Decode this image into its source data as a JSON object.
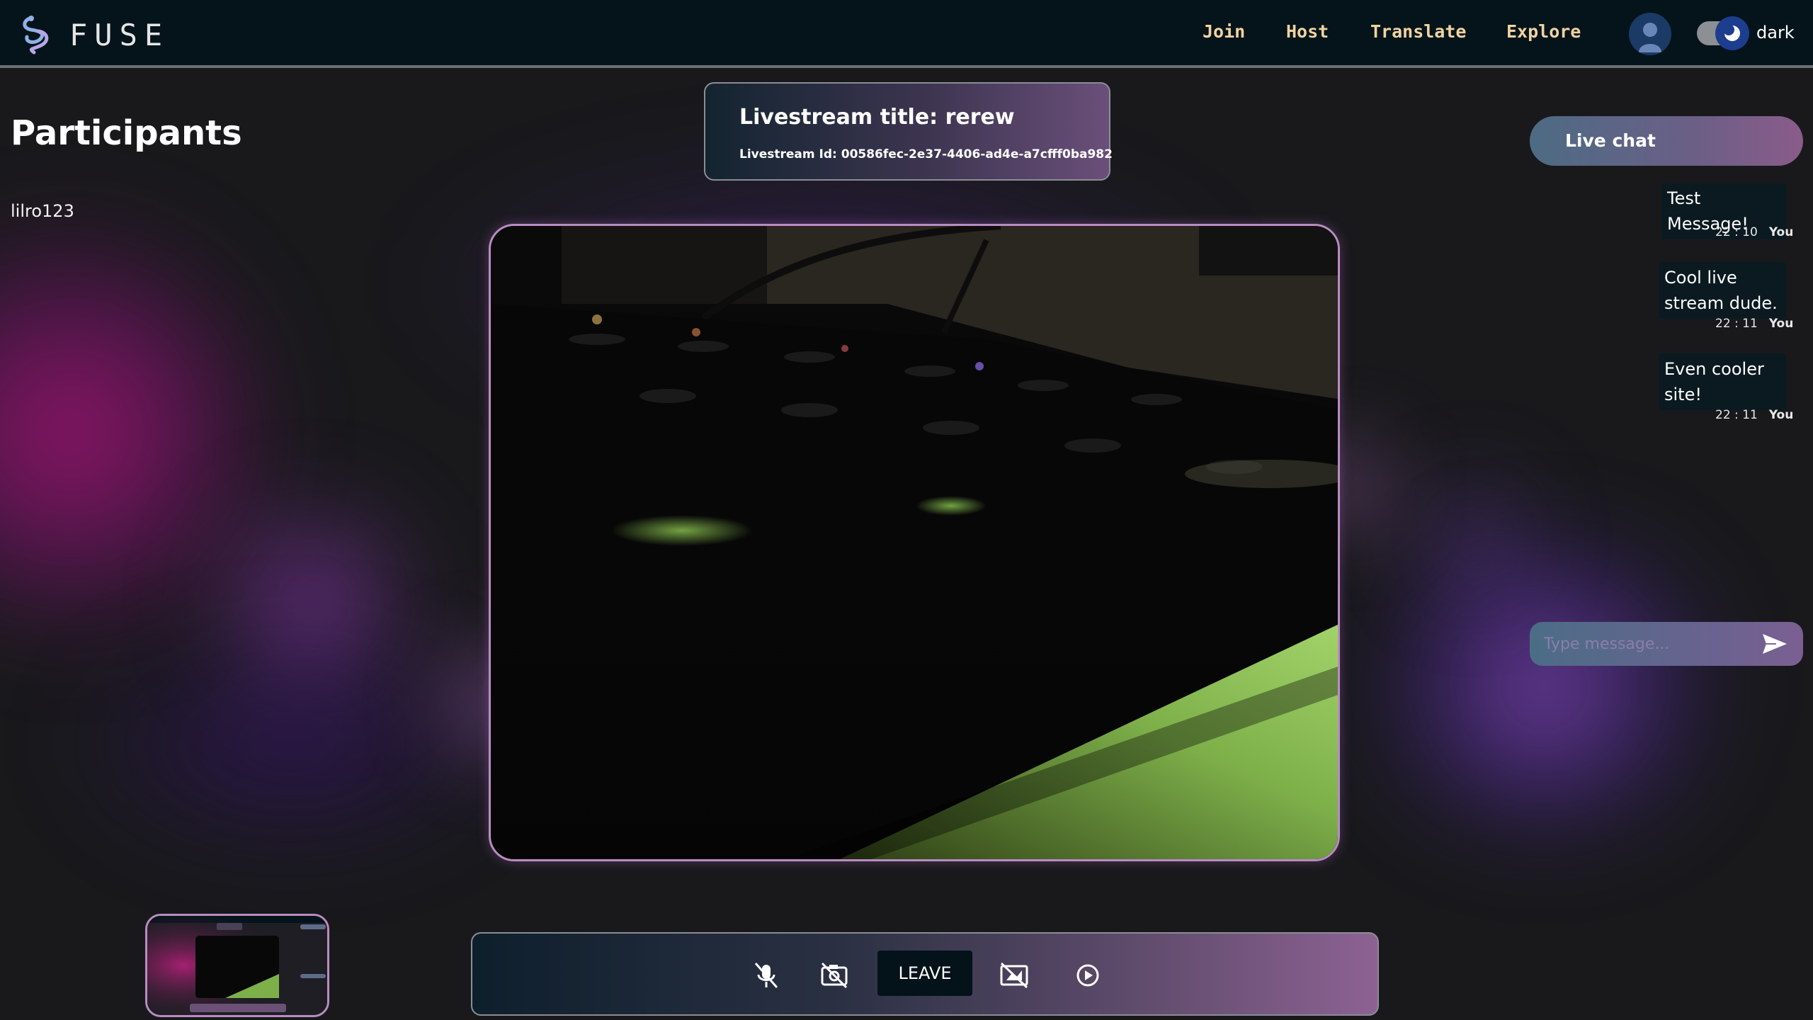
{
  "app": {
    "name": "FUSE"
  },
  "nav": {
    "items": [
      {
        "label": "Join"
      },
      {
        "label": "Host"
      },
      {
        "label": "Translate"
      },
      {
        "label": "Explore"
      }
    ],
    "theme_label": "dark"
  },
  "participants": {
    "title": "Participants",
    "list": [
      "lilro123"
    ]
  },
  "stream": {
    "title": "Livestream title: rerew",
    "id": "Livestream Id: 00586fec-2e37-4406-ad4e-a7cfff0ba982"
  },
  "chat": {
    "title": "Live chat",
    "messages": [
      {
        "text": "Test Message!",
        "time": "22 : 10",
        "author": "You"
      },
      {
        "text": "Cool live stream dude.",
        "time": "22 : 11",
        "author": "You"
      },
      {
        "text": "Even cooler site!",
        "time": "22 : 11",
        "author": "You"
      }
    ],
    "input_placeholder": "Type message..."
  },
  "controls": {
    "leave_label": "LEAVE",
    "icons": [
      "mic-off-icon",
      "camera-off-icon",
      "screen-share-off-icon",
      "record-icon"
    ]
  },
  "colors": {
    "header_bg": "#04141a",
    "nav_text": "#f1d3a3",
    "page_bg": "#19191c",
    "chat_bubble": "#0b1a20",
    "accent_purple": "#b98cc2"
  }
}
